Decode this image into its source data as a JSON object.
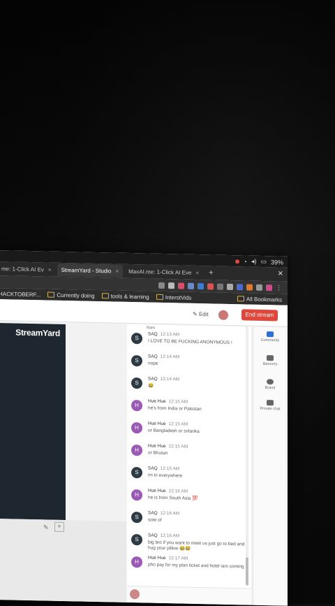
{
  "status_bar": {
    "battery": "39%"
  },
  "tabs": [
    {
      "label": "me: 1-Click AI Ev",
      "active": false
    },
    {
      "label": "StreamYard - Studio",
      "active": true
    },
    {
      "label": "MaxAI.me: 1-Click AI Eve",
      "active": false
    }
  ],
  "bookmarks": {
    "items": [
      "HACKTOBERF...",
      "Currently doing",
      "tools & learning",
      "InterstVids"
    ],
    "all_bookmarks": "All Bookmarks"
  },
  "header": {
    "edit_label": "Edit",
    "end_stream_label": "End stream"
  },
  "stage": {
    "brand": "StreamYard"
  },
  "chat": {
    "top_fragment": "from",
    "messages": [
      {
        "initial": "S",
        "author": "SAQ",
        "time": "12:13 AM",
        "text": "I LOVE TO BE FUCKING ANONYMOUS !",
        "kind": "saq"
      },
      {
        "initial": "S",
        "author": "SAQ",
        "time": "12:14 AM",
        "text": "nope",
        "kind": "saq"
      },
      {
        "initial": "S",
        "author": "SAQ",
        "time": "12:14 AM",
        "text": "😂",
        "kind": "saq"
      },
      {
        "initial": "H",
        "author": "Hue Hue",
        "time": "12:15 AM",
        "text": "he's from India or Pakistan",
        "kind": "hue"
      },
      {
        "initial": "H",
        "author": "Hue Hue",
        "time": "12:15 AM",
        "text": "or Bangladesh or srilanka",
        "kind": "hue"
      },
      {
        "initial": "H",
        "author": "Hue Hue",
        "time": "12:15 AM",
        "text": "or Bhutan",
        "kind": "hue"
      },
      {
        "initial": "S",
        "author": "SAQ",
        "time": "12:15 AM",
        "text": "im in everywhere",
        "kind": "saq"
      },
      {
        "initial": "H",
        "author": "Hue Hue",
        "time": "12:16 AM",
        "text": "he is from South Asia 💯",
        "kind": "hue"
      },
      {
        "initial": "S",
        "author": "SAQ",
        "time": "12:16 AM",
        "text": "sote of",
        "kind": "saq"
      },
      {
        "initial": "S",
        "author": "SAQ",
        "time": "12:16 AM",
        "text": "big bro if you want to meet us just go to bed and hug your pillow 😂😂",
        "kind": "saq"
      },
      {
        "initial": "H",
        "author": "Hue Hue",
        "time": "12:17 AM",
        "text": "pho pay for my plan ticket and hotel iam coming",
        "kind": "hue"
      }
    ]
  },
  "rail": [
    {
      "label": "Comments",
      "color": "#2b6fd6"
    },
    {
      "label": "Banners",
      "color": "#666666"
    },
    {
      "label": "Brand",
      "color": "#666666"
    },
    {
      "label": "Private chat",
      "color": "#666666"
    }
  ]
}
